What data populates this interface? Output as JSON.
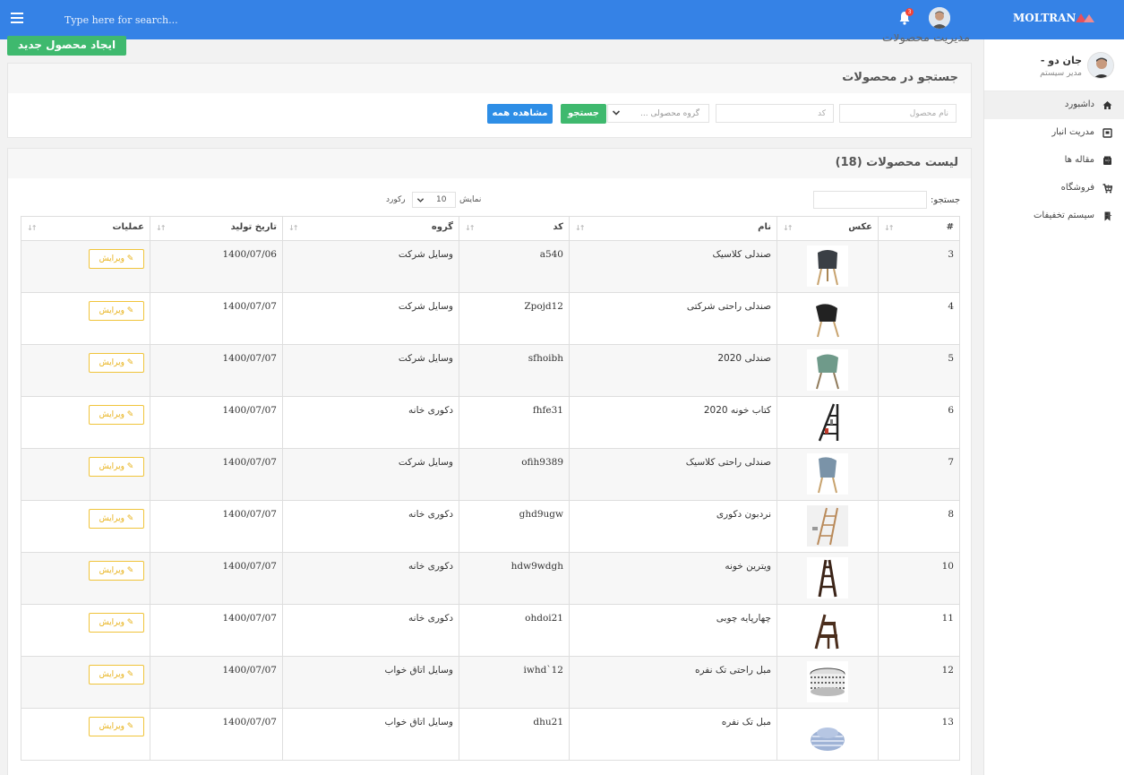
{
  "topbar": {
    "search_placeholder": "Type here for search...",
    "notification_count": "3",
    "brand": "MOLTRAN",
    "colors": {
      "bar": "#3582e6",
      "badge": "#f44336"
    }
  },
  "sidebar": {
    "user_name": "جان دو -",
    "user_role": "مدیر سیستم",
    "items": [
      {
        "label": "داشبورد",
        "icon": "home-icon",
        "active": true,
        "expandable": false
      },
      {
        "label": "مدریت انبار",
        "icon": "warehouse-icon",
        "active": false,
        "expandable": false
      },
      {
        "label": "مقاله ها",
        "icon": "article-icon",
        "active": false,
        "expandable": true
      },
      {
        "label": "فروشگاه",
        "icon": "cart-icon",
        "active": false,
        "expandable": true
      },
      {
        "label": "سیستم تخفیفات",
        "icon": "bookmark-icon",
        "active": false,
        "expandable": true
      }
    ],
    "plus_sign": "+"
  },
  "main": {
    "page_title": "مدیریت محصولات",
    "create_button": "ایجاد محصول جدید",
    "search_panel": {
      "title": "جستجو در محصولات",
      "name_placeholder": "نام محصول",
      "code_placeholder": "کد",
      "group_placeholder": "گروه محصولی ...",
      "search_button": "جستجو",
      "show_all_button": "مشاهده همه"
    },
    "list_panel": {
      "title": "لیست محصولات (18)",
      "search_label": "جستجو:",
      "show_label": "نمایش",
      "page_length": "10",
      "records_label": "رکورد",
      "columns": [
        "#",
        "عکس",
        "نام",
        "کد",
        "گروه",
        "تاریخ تولید",
        "عملیات"
      ],
      "edit_label": "ویرایش",
      "rows": [
        {
          "id": "3",
          "name": "صندلی کلاسیک",
          "code": "a540",
          "group": "وسایل شرکت",
          "date": "1400/07/06",
          "image": "chair-dark-icon"
        },
        {
          "id": "4",
          "name": "صندلی راحتی شرکتی",
          "code": "Zpojd12",
          "group": "وسایل شرکت",
          "date": "1400/07/07",
          "image": "chair-black-icon"
        },
        {
          "id": "5",
          "name": "صندلی 2020",
          "code": "sfhoibh",
          "group": "وسایل شرکت",
          "date": "1400/07/07",
          "image": "chair-green-icon"
        },
        {
          "id": "6",
          "name": "کتاب خونه 2020",
          "code": "fhfe31",
          "group": "دکوری خانه",
          "date": "1400/07/07",
          "image": "bookshelf-icon"
        },
        {
          "id": "7",
          "name": "صندلی راحتی کلاسیک",
          "code": "ofih9389",
          "group": "وسایل شرکت",
          "date": "1400/07/07",
          "image": "chair-blue-icon"
        },
        {
          "id": "8",
          "name": "نردبون دکوری",
          "code": "ghd9ugw",
          "group": "دکوری خانه",
          "date": "1400/07/07",
          "image": "ladder-icon"
        },
        {
          "id": "10",
          "name": "ویترین خونه",
          "code": "hdw9wdgh",
          "group": "دکوری خانه",
          "date": "1400/07/07",
          "image": "ladder-shelf-icon"
        },
        {
          "id": "11",
          "name": "چهارپایه چوبی",
          "code": "ohdoi21",
          "group": "دکوری خانه",
          "date": "1400/07/07",
          "image": "step-stool-icon"
        },
        {
          "id": "12",
          "name": "مبل راحتی تک نفره",
          "code": "iwhd`12",
          "group": "وسایل اتاق خواب",
          "date": "1400/07/07",
          "image": "pouf-icon"
        },
        {
          "id": "13",
          "name": "مبل تک نفره",
          "code": "dhu21",
          "group": "وسایل اتاق خواب",
          "date": "1400/07/07",
          "image": "beanbag-icon"
        }
      ]
    }
  }
}
